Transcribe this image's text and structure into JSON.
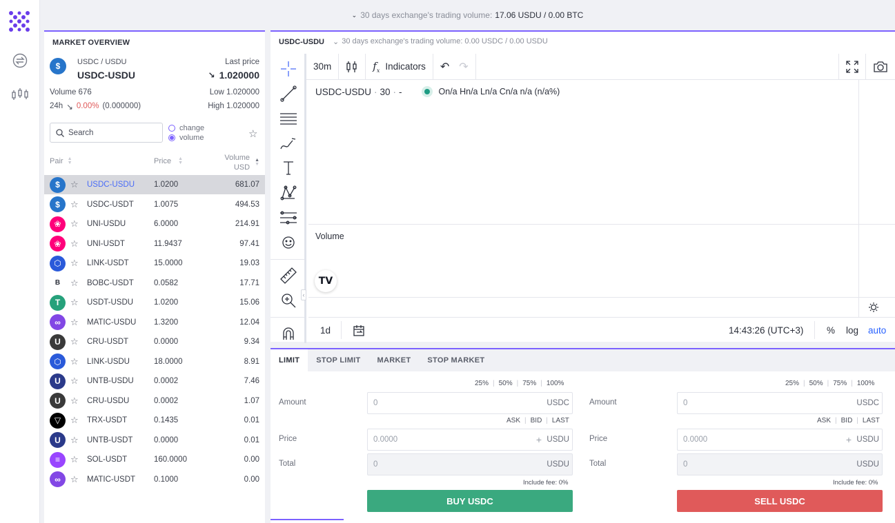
{
  "top_bar": {
    "label": "30 days exchange's trading volume:",
    "value": "17.06 USDU / 0.00 BTC"
  },
  "market": {
    "title": "MARKET OVERVIEW",
    "pair_full": "USDC / USDU",
    "pair": "USDC-USDU",
    "last_price_label": "Last price",
    "last_price": "1.020000",
    "volume_label": "Volume 676",
    "low_label": "Low 1.020000",
    "change_prefix": "24h",
    "change_pct": "0.00%",
    "change_abs": "(0.000000)",
    "high_label": "High 1.020000",
    "search_placeholder": "Search",
    "radio_change": "change",
    "radio_volume": "volume",
    "col_pair": "Pair",
    "col_price": "Price",
    "col_volume_1": "Volume",
    "col_volume_2": "USD",
    "rows": [
      {
        "pair": "USDC-USDU",
        "price": "1.0200",
        "volume": "681.07",
        "icon": "usdc-icon",
        "color": "#2775ca"
      },
      {
        "pair": "USDC-USDT",
        "price": "1.0075",
        "volume": "494.53",
        "icon": "usdc-icon",
        "color": "#2775ca"
      },
      {
        "pair": "UNI-USDU",
        "price": "6.0000",
        "volume": "214.91",
        "icon": "uni-icon",
        "color": "#ff007a"
      },
      {
        "pair": "UNI-USDT",
        "price": "11.9437",
        "volume": "97.41",
        "icon": "uni-icon",
        "color": "#ff007a"
      },
      {
        "pair": "LINK-USDT",
        "price": "15.0000",
        "volume": "19.03",
        "icon": "link-icon",
        "color": "#2a5ada"
      },
      {
        "pair": "BOBC-USDT",
        "price": "0.0582",
        "volume": "17.71",
        "icon": "bob-icon",
        "color": "#ffffff"
      },
      {
        "pair": "USDT-USDU",
        "price": "1.0200",
        "volume": "15.06",
        "icon": "usdt-icon",
        "color": "#26a17b"
      },
      {
        "pair": "MATIC-USDU",
        "price": "1.3200",
        "volume": "12.04",
        "icon": "matic-icon",
        "color": "#8247e5"
      },
      {
        "pair": "CRU-USDT",
        "price": "0.0000",
        "volume": "9.34",
        "icon": "cru-icon",
        "color": "#3a3a3a"
      },
      {
        "pair": "LINK-USDU",
        "price": "18.0000",
        "volume": "8.91",
        "icon": "link-icon",
        "color": "#2a5ada"
      },
      {
        "pair": "UNTB-USDU",
        "price": "0.0002",
        "volume": "7.46",
        "icon": "untb-icon",
        "color": "#2b3a8a"
      },
      {
        "pair": "CRU-USDU",
        "price": "0.0002",
        "volume": "1.07",
        "icon": "cru-icon",
        "color": "#3a3a3a"
      },
      {
        "pair": "TRX-USDT",
        "price": "0.1435",
        "volume": "0.01",
        "icon": "trx-icon",
        "color": "#000000"
      },
      {
        "pair": "UNTB-USDT",
        "price": "0.0000",
        "volume": "0.01",
        "icon": "untb-icon",
        "color": "#2b3a8a"
      },
      {
        "pair": "SOL-USDT",
        "price": "160.0000",
        "volume": "0.00",
        "icon": "sol-icon",
        "color": "#9945ff"
      },
      {
        "pair": "MATIC-USDT",
        "price": "0.1000",
        "volume": "0.00",
        "icon": "matic-icon",
        "color": "#8247e5"
      }
    ]
  },
  "chart": {
    "symbol": "USDC-USDU",
    "volume_text": "30 days exchange's trading volume: 0.00 USDC / 0.00 USDU",
    "interval": "30m",
    "indicators": "Indicators",
    "legend_symbol": "USDC-USDU",
    "legend_interval": "30",
    "legend_dash": "-",
    "legend_ohlc": "On/a Hn/a Ln/a Cn/a n/a (n/a%)",
    "volume_pane": "Volume",
    "range": "1d",
    "time": "14:43:26 (UTC+3)",
    "pct": "%",
    "log": "log",
    "auto": "auto"
  },
  "orders": {
    "tabs": [
      "LIMIT",
      "STOP LIMIT",
      "MARKET",
      "STOP MARKET"
    ],
    "pcts": [
      "25%",
      "50%",
      "75%",
      "100%"
    ],
    "price_opts": [
      "ASK",
      "BID",
      "LAST"
    ],
    "amount_label": "Amount",
    "price_label": "Price",
    "total_label": "Total",
    "amount_ph": "0",
    "price_ph": "0.0000",
    "total_ph": "0",
    "buy_amount_cur": "USDC",
    "buy_price_cur": "USDU",
    "buy_total_cur": "USDU",
    "sell_amount_cur": "USDC",
    "sell_price_cur": "USDU",
    "sell_total_cur": "USDU",
    "fee": "Include fee: 0%",
    "buy_button": "BUY USDC",
    "sell_button": "SELL USDC",
    "buy_color": "#3aa97f",
    "sell_color": "#e05a5a"
  }
}
